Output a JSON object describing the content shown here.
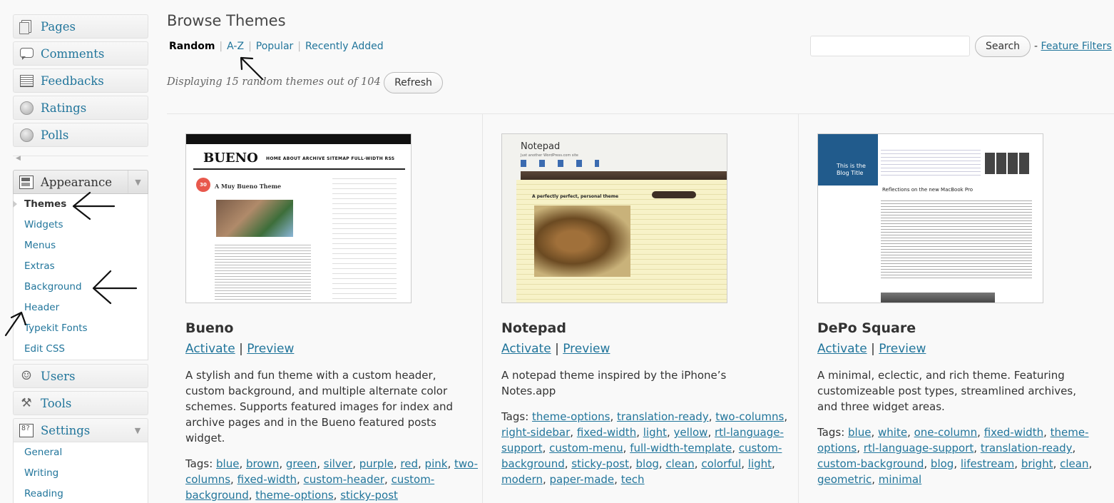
{
  "sidebar": {
    "top_items": [
      {
        "label": "Pages",
        "icon": "pages-icon"
      },
      {
        "label": "Comments",
        "icon": "comments-icon"
      },
      {
        "label": "Feedbacks",
        "icon": "feedbacks-icon"
      },
      {
        "label": "Ratings",
        "icon": "ratings-icon"
      },
      {
        "label": "Polls",
        "icon": "polls-icon"
      }
    ],
    "appearance": {
      "label": "Appearance",
      "submenu": [
        "Themes",
        "Widgets",
        "Menus",
        "Extras",
        "Background",
        "Header",
        "Typekit Fonts",
        "Edit CSS"
      ],
      "current": "Themes"
    },
    "users_label": "Users",
    "tools_label": "Tools",
    "settings": {
      "label": "Settings",
      "submenu": [
        "General",
        "Writing",
        "Reading"
      ]
    }
  },
  "main": {
    "title": "Browse Themes",
    "filters": {
      "current": "Random",
      "links": [
        "A-Z",
        "Popular",
        "Recently Added"
      ],
      "separator": "|"
    },
    "search_button": "Search",
    "feature_filters_prefix": "-",
    "feature_filters": "Feature Filters",
    "displaying_text": "Displaying 15 random themes out of 104",
    "refresh_button": "Refresh",
    "actions": {
      "activate": "Activate",
      "separator": "|",
      "preview": "Preview"
    },
    "tags_label": "Tags:",
    "themes": [
      {
        "name": "Bueno",
        "description": "A stylish and fun theme with a custom header, custom background, and multiple alternate color schemes. Supports featured images for index and archive pages and in the Bueno featured posts widget.",
        "tags": [
          "blue",
          "brown",
          "green",
          "silver",
          "purple",
          "red",
          "pink",
          "two-columns",
          "fixed-width",
          "custom-header",
          "custom-background",
          "theme-options",
          "sticky-post"
        ],
        "thumb": {
          "logo": "BUENO",
          "nav": "HOME  ABOUT  ARCHIVE  SITEMAP  FULL-WIDTH  RSS",
          "post_title": "A Muy Bueno Theme",
          "date_badge": "30"
        }
      },
      {
        "name": "Notepad",
        "description": "A notepad theme inspired by the iPhone’s Notes.app",
        "tags": [
          "theme-options",
          "translation-ready",
          "two-columns",
          "right-sidebar",
          "fixed-width",
          "light",
          "yellow",
          "rtl-language-support",
          "custom-menu",
          "full-width-template",
          "custom-background",
          "sticky-post",
          "blog",
          "clean",
          "colorful",
          "light",
          "modern",
          "paper-made",
          "tech"
        ],
        "thumb": {
          "title": "Notepad",
          "subtitle": "Just another WordPress.com site",
          "post_title": "A perfectly perfect, personal theme"
        }
      },
      {
        "name": "DePo Square",
        "description": "A minimal, eclectic, and rich theme. Featuring customizeable post types, streamlined archives, and three widget areas.",
        "tags": [
          "blue",
          "white",
          "one-column",
          "fixed-width",
          "theme-options",
          "rtl-language-support",
          "translation-ready",
          "custom-background",
          "blog",
          "lifestream",
          "bright",
          "clean",
          "geometric",
          "minimal"
        ],
        "thumb": {
          "blog_title": "This is the Blog Title",
          "post_title": "Reflections on the new MacBook Pro"
        }
      }
    ]
  },
  "colors": {
    "link": "#21759b",
    "accent_red": "#e8584c",
    "depo_blue": "#215b8c"
  }
}
